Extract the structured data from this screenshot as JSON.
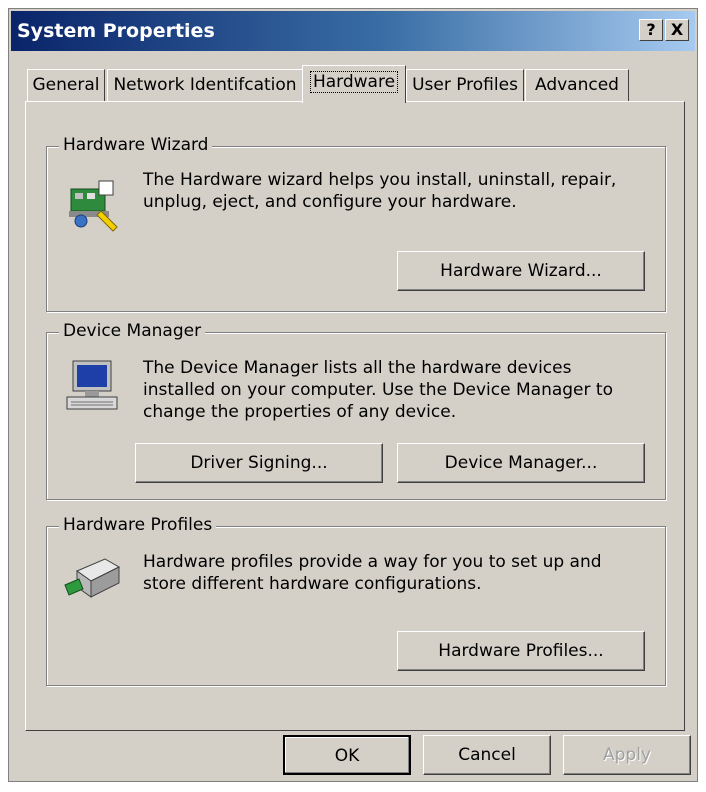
{
  "window": {
    "title": "System Properties",
    "help": "?",
    "close": "X"
  },
  "tabs": [
    {
      "label": "General"
    },
    {
      "label": "Network Identifcation"
    },
    {
      "label": "Hardware"
    },
    {
      "label": "User Profiles"
    },
    {
      "label": "Advanced"
    }
  ],
  "hardware_wizard": {
    "label": "Hardware Wizard",
    "description": "The Hardware wizard helps you install, uninstall, repair, unplug, eject, and configure your hardware.",
    "button": "Hardware Wizard..."
  },
  "device_manager": {
    "label": "Device Manager",
    "description": "The Device Manager lists all the hardware devices installed on your computer. Use the Device Manager to change the properties of any device.",
    "driver_signing_button": "Driver Signing...",
    "device_manager_button": "Device Manager..."
  },
  "hardware_profiles": {
    "label": "Hardware Profiles",
    "description": "Hardware profiles provide a way for you to set up and store different hardware configurations.",
    "button": "Hardware Profiles..."
  },
  "footer": {
    "ok": "OK",
    "cancel": "Cancel",
    "apply": "Apply"
  },
  "colors": {
    "title_bar": "#0a246a",
    "dialog_face": "#d4d0c8"
  }
}
